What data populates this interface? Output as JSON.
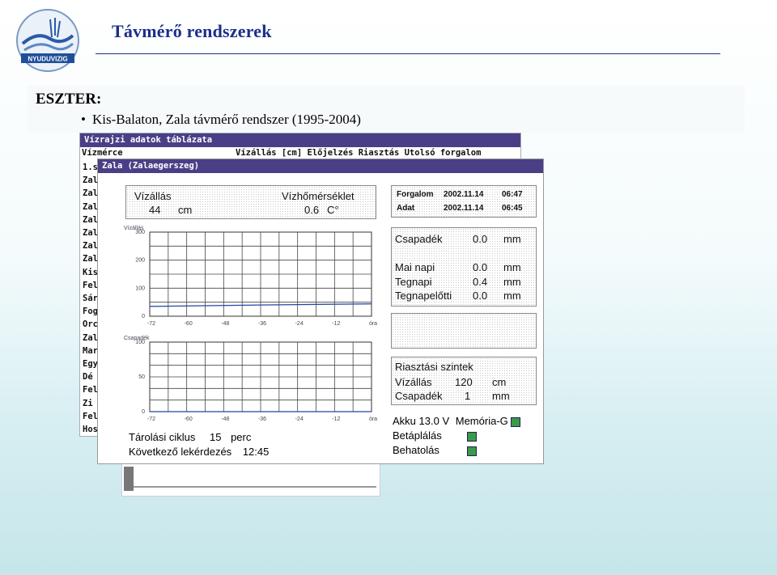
{
  "header": {
    "title": "Távmérő rendszerek",
    "logo_text": "NYUDUVIZIG"
  },
  "slide": {
    "heading": "ESZTER:",
    "bullet": "Kis-Balaton, Zala távmérő rendszer (1995-2004)"
  },
  "back_window": {
    "title": "Vízrajzi adatok táblázata",
    "col_left": "Vízmérce",
    "col_right": "Vízállás [cm] Előjelzés Riasztás Utolsó forgalom",
    "rows": [
      "1.s",
      "Zal",
      "Zal",
      "Zal",
      "Zal",
      "Zal",
      "Zal",
      "Zal",
      "Kis",
      "Fel",
      "Sár",
      "Fog",
      "Orc",
      "Zal",
      "Mar",
      "Egy",
      "Dé",
      "Fel",
      "Zi",
      "Fel",
      "Hos"
    ]
  },
  "window": {
    "title": "Zala (Zalaegerszeg)",
    "water_level_label": "Vízállás",
    "water_level_value": "44",
    "water_level_unit": "cm",
    "water_temp_label": "Vízhőmérséklet",
    "water_temp_value": "0.6",
    "water_temp_unit": "C°",
    "traffic_label": "Forgalom",
    "traffic_date": "2002.11.14",
    "traffic_time": "06:47",
    "data_label": "Adat",
    "data_date": "2002.11.14",
    "data_time": "06:45",
    "precip_label": "Csapadék",
    "precip_value": "0.0",
    "precip_unit": "mm",
    "today_label": "Mai napi",
    "today_value": "0.0",
    "today_unit": "mm",
    "yesterday_label": "Tegnapi",
    "yesterday_value": "0.4",
    "yesterday_unit": "mm",
    "daybefore_label": "Tegnapelőtti",
    "daybefore_value": "0.0",
    "daybefore_unit": "mm",
    "alarm_title": "Riasztási szintek",
    "alarm_level_label": "Vízállás",
    "alarm_level_value": "120",
    "alarm_level_unit": "cm",
    "alarm_precip_label": "Csapadék",
    "alarm_precip_value": "1",
    "alarm_precip_unit": "mm",
    "akku_label": "Akku",
    "akku_value": "13.0 V",
    "memory_label": "Memória-G",
    "inbound_label": "Betáplálás",
    "intrusion_label": "Behatolás",
    "storage_label": "Tárolási ciklus",
    "storage_value": "15",
    "storage_unit": "perc",
    "next_label": "Következő lekérdezés",
    "next_value": "12:45",
    "indicator_color": "#3a9a4a"
  },
  "chart_data": [
    {
      "type": "line",
      "title": "Vízállás",
      "x_ticks": [
        "-72",
        "-60",
        "-48",
        "-36",
        "-24",
        "-12",
        "óra"
      ],
      "y_ticks": [
        "300",
        "200",
        "100",
        "0"
      ],
      "ylim": [
        0,
        300
      ],
      "series": [
        {
          "x": [
            -72,
            -36,
            0
          ],
          "values": [
            35,
            40,
            44
          ]
        }
      ]
    },
    {
      "type": "line",
      "title": "Csapadék",
      "x_ticks": [
        "-72",
        "-60",
        "-48",
        "-36",
        "-24",
        "-12",
        "óra"
      ],
      "y_ticks": [
        "100",
        "50",
        "0"
      ],
      "ylim": [
        0,
        100
      ],
      "series": [
        {
          "x": [
            -72,
            0
          ],
          "values": [
            0,
            0
          ]
        }
      ]
    }
  ]
}
